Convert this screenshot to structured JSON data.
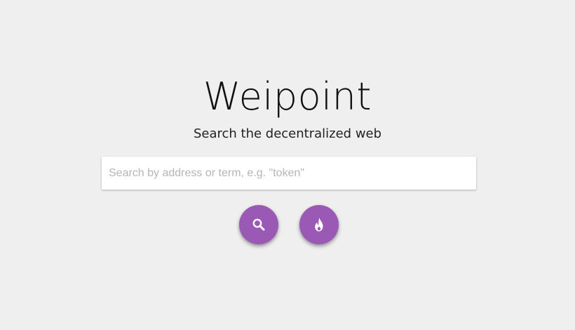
{
  "header": {
    "title": "Weipoint",
    "subtitle": "Search the decentralized web"
  },
  "search": {
    "value": "",
    "placeholder": "Search by address or term, e.g. \"token\""
  },
  "actions": {
    "search_icon": "search-icon",
    "trending_icon": "fire-icon"
  },
  "colors": {
    "accent": "#9b59b6",
    "background": "#efefef",
    "icon": "#ffffff"
  }
}
